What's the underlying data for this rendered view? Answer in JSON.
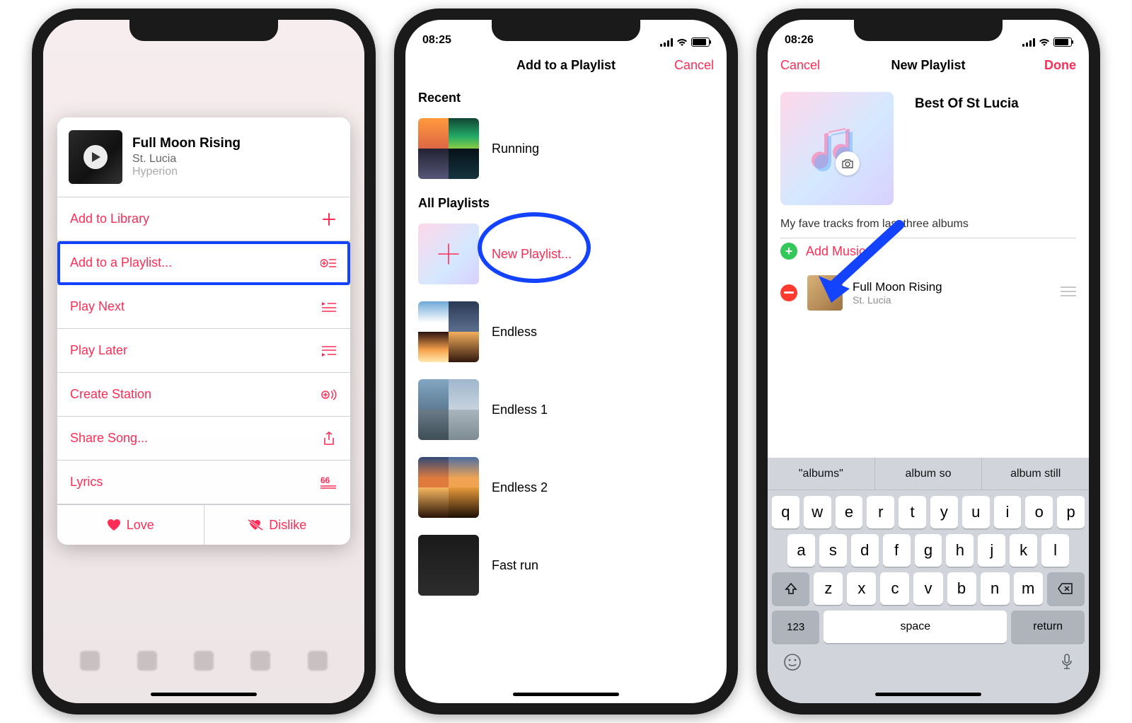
{
  "phone1": {
    "song": {
      "title": "Full Moon Rising",
      "artist": "St. Lucia",
      "album": "Hyperion"
    },
    "items": [
      {
        "label": "Add to Library",
        "icon": "plus"
      },
      {
        "label": "Add to a Playlist...",
        "icon": "add-to-playlist"
      },
      {
        "label": "Play Next",
        "icon": "play-next"
      },
      {
        "label": "Play Later",
        "icon": "play-later"
      },
      {
        "label": "Create Station",
        "icon": "station"
      },
      {
        "label": "Share Song...",
        "icon": "share"
      },
      {
        "label": "Lyrics",
        "icon": "lyrics"
      }
    ],
    "love": "Love",
    "dislike": "Dislike"
  },
  "phone2": {
    "time": "08:25",
    "title": "Add to a Playlist",
    "cancel": "Cancel",
    "recent_head": "Recent",
    "all_head": "All Playlists",
    "recent": [
      {
        "name": "Running"
      }
    ],
    "new_label": "New Playlist...",
    "all": [
      {
        "name": "Endless"
      },
      {
        "name": "Endless 1"
      },
      {
        "name": "Endless 2"
      },
      {
        "name": "Fast run"
      }
    ]
  },
  "phone3": {
    "time": "08:26",
    "title": "New Playlist",
    "cancel": "Cancel",
    "done": "Done",
    "name": "Best Of St Lucia",
    "desc": "My fave tracks from last three albums",
    "add": "Add Music",
    "track": {
      "title": "Full Moon Rising",
      "artist": "St. Lucia"
    },
    "sugg": [
      "\"albums\"",
      "album so",
      "album still"
    ],
    "rows": [
      [
        "q",
        "w",
        "e",
        "r",
        "t",
        "y",
        "u",
        "i",
        "o",
        "p"
      ],
      [
        "a",
        "s",
        "d",
        "f",
        "g",
        "h",
        "j",
        "k",
        "l"
      ],
      [
        "z",
        "x",
        "c",
        "v",
        "b",
        "n",
        "m"
      ]
    ],
    "k123": "123",
    "space": "space",
    "ret": "return"
  }
}
